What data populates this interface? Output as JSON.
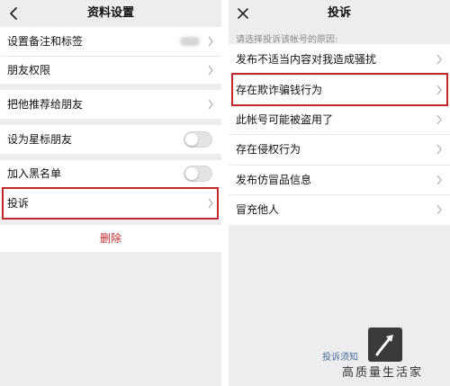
{
  "left": {
    "title": "资料设置",
    "rows": {
      "remark": "设置备注和标签",
      "permissions": "朋友权限",
      "recommend": "把他推荐给朋友",
      "star": "设为星标朋友",
      "blacklist": "加入黑名单",
      "complain": "投诉"
    },
    "delete_label": "删除"
  },
  "right": {
    "title": "投诉",
    "hint": "请选择投诉该帐号的原因:",
    "reasons": [
      "发布不适当内容对我造成骚扰",
      "存在欺诈骗钱行为",
      "此帐号可能被盗用了",
      "存在侵权行为",
      "发布仿冒品信息",
      "冒充他人"
    ],
    "footer_link": "投诉须知"
  },
  "watermark": {
    "text": "高质量生活家"
  },
  "colors": {
    "highlight": "#c0282d",
    "delete": "#c0282d",
    "link": "#4a6b9a",
    "background": "#ededed"
  },
  "toggles": {
    "star": false,
    "blacklist": false
  }
}
